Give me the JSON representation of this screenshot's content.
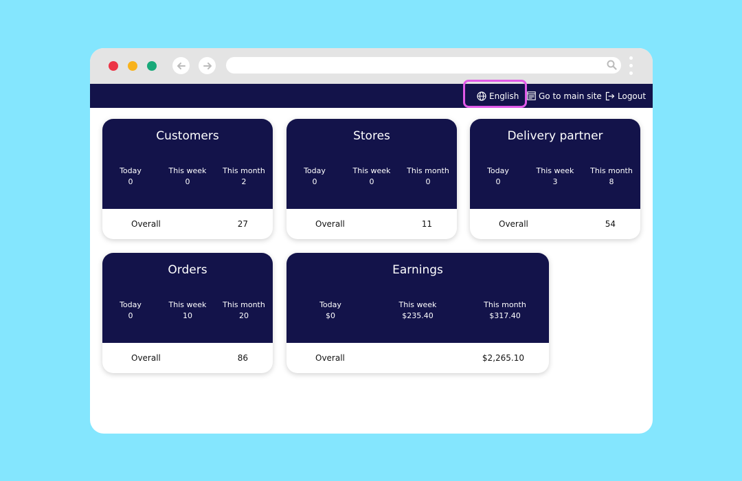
{
  "nav": {
    "language": "English",
    "main_site": "Go to main site",
    "logout": "Logout"
  },
  "colors": {
    "background": "#84e6fe",
    "nav": "#13134a",
    "highlight": "#e05ae8"
  },
  "cards": {
    "customers": {
      "title": "Customers",
      "today_label": "Today",
      "today": "0",
      "week_label": "This week",
      "week": "0",
      "month_label": "This month",
      "month": "2",
      "overall_label": "Overall",
      "overall": "27"
    },
    "stores": {
      "title": "Stores",
      "today_label": "Today",
      "today": "0",
      "week_label": "This week",
      "week": "0",
      "month_label": "This month",
      "month": "0",
      "overall_label": "Overall",
      "overall": "11"
    },
    "delivery": {
      "title": "Delivery partner",
      "today_label": "Today",
      "today": "0",
      "week_label": "This week",
      "week": "3",
      "month_label": "This month",
      "month": "8",
      "overall_label": "Overall",
      "overall": "54"
    },
    "orders": {
      "title": "Orders",
      "today_label": "Today",
      "today": "0",
      "week_label": "This week",
      "week": "10",
      "month_label": "This month",
      "month": "20",
      "overall_label": "Overall",
      "overall": "86"
    },
    "earnings": {
      "title": "Earnings",
      "today_label": "Today",
      "today": "$0",
      "week_label": "This week",
      "week": "$235.40",
      "month_label": "This month",
      "month": "$317.40",
      "overall_label": "Overall",
      "overall": "$2,265.10"
    }
  }
}
